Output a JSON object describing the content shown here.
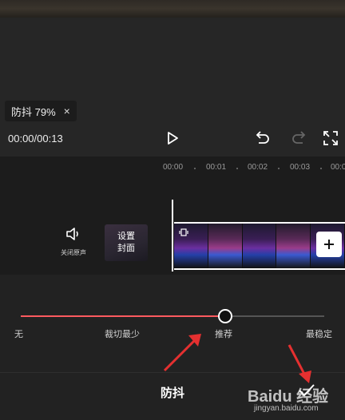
{
  "badge": {
    "label": "防抖 79%",
    "close": "×"
  },
  "player": {
    "time": "00:00/00:13"
  },
  "ruler": {
    "ticks": [
      "00:00",
      "00:01",
      "00:02",
      "00:03",
      "00:0"
    ]
  },
  "track": {
    "mute_label": "关闭原声",
    "cover_line1": "设置",
    "cover_line2": "封面"
  },
  "stabilize": {
    "stops": [
      "无",
      "裁切最少",
      "推荐",
      "最稳定"
    ],
    "level_percent": 67
  },
  "bottom": {
    "title": "防抖"
  },
  "watermark": {
    "brand": "Baidu 经验",
    "url": "jingyan.baidu.com"
  },
  "colors": {
    "accent": "#ff5a5f",
    "annotation": "#e53030"
  }
}
